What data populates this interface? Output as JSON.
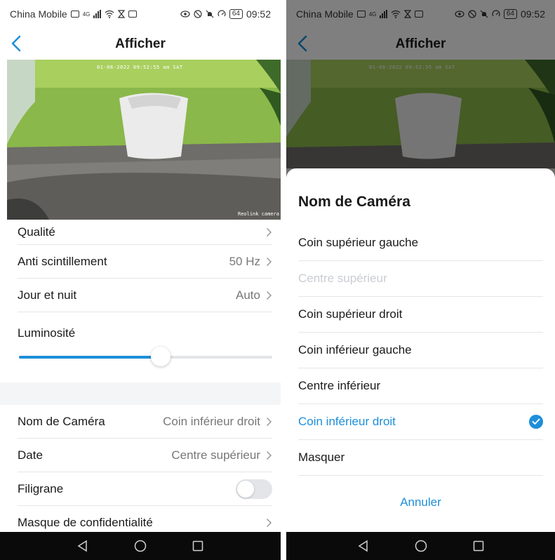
{
  "status_bar": {
    "carrier": "China Mobile",
    "network": "4G",
    "battery": "64",
    "time": "09:52"
  },
  "header": {
    "title": "Afficher"
  },
  "preview": {
    "timestamp": "01-08-2022 09:52:55 am SAT",
    "camera_label": "Reolink camera"
  },
  "settings": {
    "quality": {
      "label": "Qualité"
    },
    "anti_flicker": {
      "label": "Anti scintillement",
      "value": "50 Hz"
    },
    "day_night": {
      "label": "Jour et nuit",
      "value": "Auto"
    },
    "brightness": {
      "label": "Luminosité",
      "level_percent": 56
    },
    "camera_name": {
      "label": "Nom de Caméra",
      "value": "Coin inférieur droit"
    },
    "date": {
      "label": "Date",
      "value": "Centre supérieur"
    },
    "watermark": {
      "label": "Filigrane",
      "enabled": false
    },
    "privacy_mask": {
      "label": "Masque de confidentialité"
    }
  },
  "sheet": {
    "title": "Nom de Caméra",
    "options": [
      {
        "label": "Coin supérieur gauche",
        "state": "normal"
      },
      {
        "label": "Centre supérieur",
        "state": "disabled"
      },
      {
        "label": "Coin supérieur droit",
        "state": "normal"
      },
      {
        "label": "Coin inférieur gauche",
        "state": "normal"
      },
      {
        "label": "Centre inférieur",
        "state": "normal"
      },
      {
        "label": "Coin inférieur droit",
        "state": "selected"
      },
      {
        "label": "Masquer",
        "state": "normal"
      }
    ],
    "cancel_label": "Annuler"
  },
  "colors": {
    "accent": "#1e8fd9",
    "disabled": "#c9ccd1",
    "divider": "#e6e6e6",
    "section_bg": "#f4f5f7"
  },
  "icons": {
    "back": "chevron-left-icon",
    "row_chevron": "chevron-right-icon",
    "selected": "check-circle-icon",
    "nav_back": "triangle-back-icon",
    "nav_home": "circle-home-icon",
    "nav_recent": "square-recent-icon"
  }
}
